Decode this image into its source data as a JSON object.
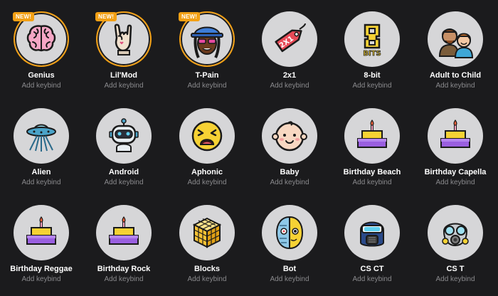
{
  "colors": {
    "background": "#1b1b1d",
    "circle": "#d6d6d8",
    "badge": "#f3a014",
    "keybind_text": "#8a8a8d"
  },
  "voices": [
    {
      "name": "Genius",
      "keybind": "Add keybind",
      "badge": "NEW!",
      "icon": "brain-icon"
    },
    {
      "name": "Lil'Mod",
      "keybind": "Add keybind",
      "badge": "NEW!",
      "icon": "rock-hand-icon"
    },
    {
      "name": "T-Pain",
      "keybind": "Add keybind",
      "badge": "NEW!",
      "icon": "tpain-face-icon"
    },
    {
      "name": "2x1",
      "keybind": "Add keybind",
      "icon": "price-tag-icon"
    },
    {
      "name": "8-bit",
      "keybind": "Add keybind",
      "icon": "eight-bits-icon"
    },
    {
      "name": "Adult to Child",
      "keybind": "Add keybind",
      "icon": "adult-child-icon"
    },
    {
      "name": "Alien",
      "keybind": "Add keybind",
      "icon": "ufo-icon"
    },
    {
      "name": "Android",
      "keybind": "Add keybind",
      "icon": "robot-icon"
    },
    {
      "name": "Aphonic",
      "keybind": "Add keybind",
      "icon": "tired-face-icon"
    },
    {
      "name": "Baby",
      "keybind": "Add keybind",
      "icon": "baby-face-icon"
    },
    {
      "name": "Birthday Beach",
      "keybind": "Add keybind",
      "icon": "birthday-cake-icon"
    },
    {
      "name": "Birthday Capella",
      "keybind": "Add keybind",
      "icon": "birthday-cake-icon"
    },
    {
      "name": "Birthday Reggae",
      "keybind": "Add keybind",
      "icon": "birthday-cake-icon"
    },
    {
      "name": "Birthday Rock",
      "keybind": "Add keybind",
      "icon": "birthday-cake-icon"
    },
    {
      "name": "Blocks",
      "keybind": "Add keybind",
      "icon": "cube-blocks-icon"
    },
    {
      "name": "Bot",
      "keybind": "Add keybind",
      "icon": "cyborg-face-icon"
    },
    {
      "name": "CS CT",
      "keybind": "Add keybind",
      "icon": "ct-helmet-icon"
    },
    {
      "name": "CS T",
      "keybind": "Add keybind",
      "icon": "gas-mask-icon"
    }
  ]
}
